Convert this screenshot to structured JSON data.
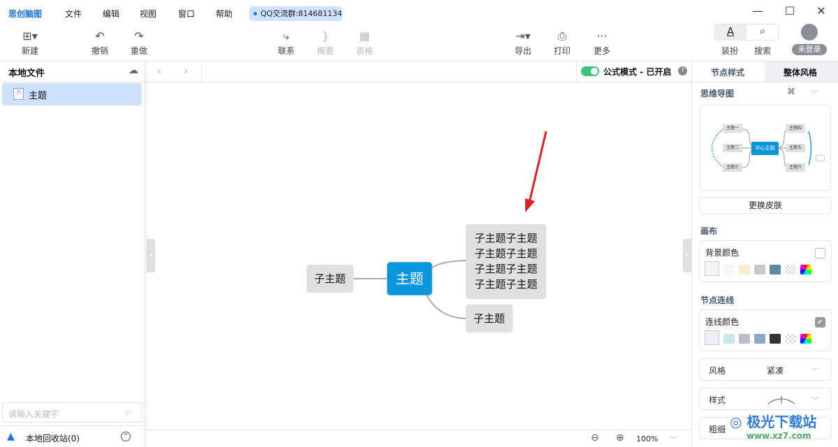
{
  "app": {
    "name": "思创脑图",
    "menus": [
      "文件",
      "编辑",
      "视图",
      "窗口",
      "帮助"
    ],
    "qq_badge": "QQ交流群:814681134"
  },
  "window": {
    "minimize": "—",
    "maximize": "☐",
    "close": "✕"
  },
  "toolbar": {
    "new": "新建",
    "undo": "撤销",
    "redo": "重做",
    "link": "联系",
    "summary": "概要",
    "table": "表格",
    "export": "导出",
    "print": "打印",
    "more": "更多",
    "dress": "装扮",
    "search": "搜索",
    "login": "未登录"
  },
  "left_panel": {
    "title": "本地文件",
    "files": [
      {
        "name": "主题",
        "selected": true
      }
    ],
    "search_placeholder": "请输入关键字",
    "recycle": "本地回收站(0)"
  },
  "canvas": {
    "formula_mode": "公式模式 - 已开启",
    "formula_on": true,
    "zoom": "100%",
    "mindmap": {
      "center": "主题",
      "left": [
        "子主题"
      ],
      "right": [
        [
          "子主题子主题",
          "子主题子主题",
          "子主题子主题",
          "子主题子主题"
        ],
        [
          "子主题"
        ]
      ]
    },
    "accent": "#0a95dd"
  },
  "right_panel": {
    "tabs": [
      "节点样式",
      "整体风格"
    ],
    "active_tab": 1,
    "mindmap_section": "思维导图",
    "preview": {
      "center": "中心主题",
      "left": [
        "主题一",
        "主题二",
        "主题三"
      ],
      "right": [
        "主题四",
        "主题五",
        "主题六"
      ]
    },
    "change_skin": "更换皮肤",
    "canvas_section": "画布",
    "bg_color_label": "背景颜色",
    "bg_colors": [
      "#f4f4f4",
      "#f1f8f8",
      "#fdebd0",
      "#c8c8c8",
      "#5a8b9e"
    ],
    "line_section": "节点连线",
    "line_color_label": "连线颜色",
    "line_colors": [
      "#eeeff4",
      "#cde6ea",
      "#b7bccf",
      "#8ea6c7",
      "#333333"
    ],
    "style_label": "风格",
    "style_value": "紧凑",
    "shape_label": "样式",
    "thickness_label": "粗细"
  },
  "watermark": "极光下载站 www.xz7.com"
}
